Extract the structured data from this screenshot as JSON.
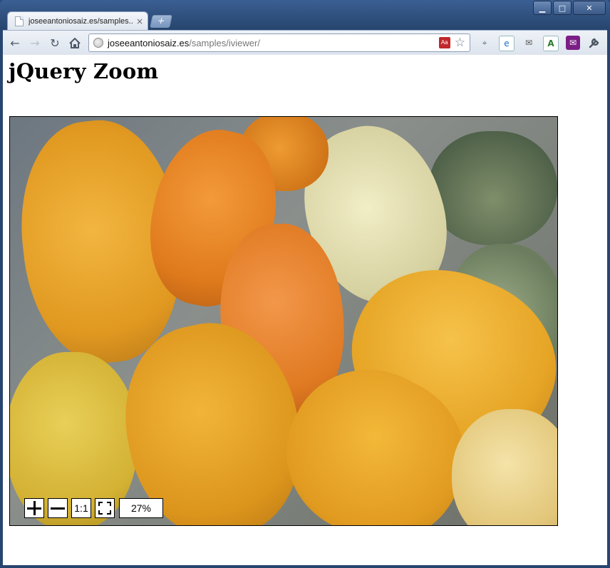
{
  "window": {
    "controls": {
      "minimize": "▁",
      "maximize": "□",
      "close": "✕"
    }
  },
  "tab": {
    "title": "joseeantoniosaiz.es/samples...",
    "close": "×"
  },
  "new_tab_label": "+",
  "toolbar": {
    "back_icon": "back-arrow-icon",
    "forward_icon": "forward-arrow-icon",
    "reload_icon": "reload-icon",
    "home_icon": "home-icon"
  },
  "address_bar": {
    "host": "joseeantoniosaiz.es",
    "path": "/samples/iviewer/"
  },
  "extensions": [
    "pdf-icon",
    "bookmark-star-icon",
    "pin-icon",
    "ie-tab-icon",
    "mail-checker-icon",
    "translate-icon",
    "yahoo-mail-icon",
    "wrench-menu-icon"
  ],
  "page": {
    "heading": "jQuery Zoom"
  },
  "viewer": {
    "zoom_in": "+",
    "zoom_out": "−",
    "actual_size": "1:1",
    "fit": "fit-to-screen-icon",
    "zoom_level": "27%"
  },
  "colors": {
    "frame": "#27466f",
    "pumpkin_orange": "#e08a1e",
    "pumpkin_yellow": "#e8b23a",
    "pumpkin_pale": "#e7e2b5",
    "pumpkin_green": "#6d7d5a"
  }
}
